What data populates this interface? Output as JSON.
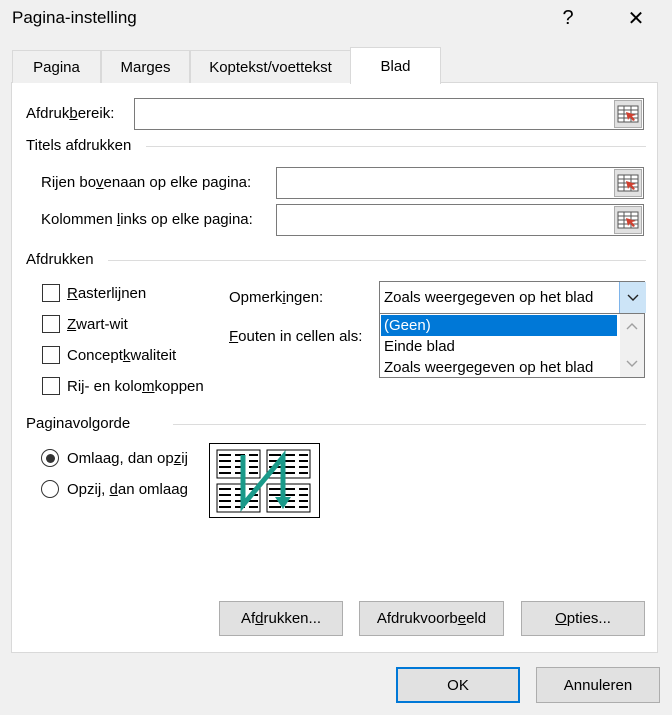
{
  "window": {
    "title": "Pagina-instelling",
    "help_glyph": "?",
    "close_glyph": "✕"
  },
  "tabs": [
    {
      "label": "Pagina"
    },
    {
      "label": "Marges"
    },
    {
      "label": "Koptekst/voettekst"
    },
    {
      "label": "Blad",
      "active": true
    }
  ],
  "print_area": {
    "label_pre": "Afdruk",
    "label_u": "b",
    "label_post": "ereik:",
    "value": ""
  },
  "print_titles": {
    "heading": "Titels afdrukken",
    "rows": {
      "label_pre": "Rijen bo",
      "label_u": "v",
      "label_post": "enaan op elke pagina:",
      "value": ""
    },
    "cols": {
      "label_pre": "Kolommen ",
      "label_u": "l",
      "label_post": "inks op elke pagina:",
      "value": ""
    }
  },
  "print": {
    "heading": "Afdrukken",
    "checkboxes": [
      {
        "pre": "",
        "u": "R",
        "post": "asterlijnen",
        "checked": false
      },
      {
        "pre": "",
        "u": "Z",
        "post": "wart-wit",
        "checked": false
      },
      {
        "pre": "Concept",
        "u": "k",
        "post": "waliteit",
        "checked": false
      },
      {
        "pre": "Rij- en kolo",
        "u": "m",
        "post": "koppen",
        "checked": false
      }
    ],
    "comments": {
      "label_pre": "Opmerk",
      "label_u": "i",
      "label_post": "ngen:",
      "value": "Zoals weergegeven op het blad",
      "options": [
        "(Geen)",
        "Einde blad",
        "Zoals weergegeven op het blad"
      ],
      "highlighted": "(Geen)"
    },
    "errors": {
      "label_pre": "",
      "label_u": "F",
      "label_post": "outen in cellen als:"
    }
  },
  "page_order": {
    "heading": "Paginavolgorde",
    "options": [
      {
        "pre": "Omlaag, dan op",
        "u": "z",
        "post": "ij",
        "selected": true
      },
      {
        "pre": "Opzij, ",
        "u": "d",
        "post": "an omlaag",
        "selected": false
      }
    ],
    "arrow_color": "#1a9a8a"
  },
  "buttons": {
    "print": {
      "pre": "Af",
      "u": "d",
      "post": "rukken..."
    },
    "preview": {
      "pre": "Afdrukvoorb",
      "u": "e",
      "post": "eld"
    },
    "options": {
      "pre": "",
      "u": "O",
      "post": "pties..."
    },
    "ok": "OK",
    "cancel": "Annuleren"
  }
}
